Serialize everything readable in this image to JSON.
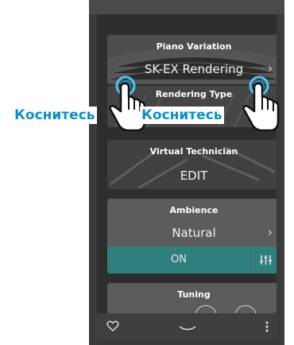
{
  "piano_variation": {
    "header": "Piano Variation",
    "value": "SK-EX Rendering"
  },
  "rendering_type": {
    "header": "Rendering Type"
  },
  "virtual_technician": {
    "header": "Virtual Technician",
    "value": "EDIT"
  },
  "ambience": {
    "header": "Ambience",
    "value": "Natural",
    "toggle": "ON"
  },
  "tuning": {
    "header": "Tuning"
  },
  "touch_label_left": "Коснитесь",
  "touch_label_right": "Коснитесь",
  "icons": {
    "chevron": "chevron-right-icon",
    "ambience_settings": "equalizer-icon",
    "favorite": "heart-icon",
    "collapse": "chevron-down-icon",
    "more": "more-vertical-icon"
  },
  "colors": {
    "accent": "#2f7f7f",
    "touch_blue": "#0d8fc8"
  }
}
